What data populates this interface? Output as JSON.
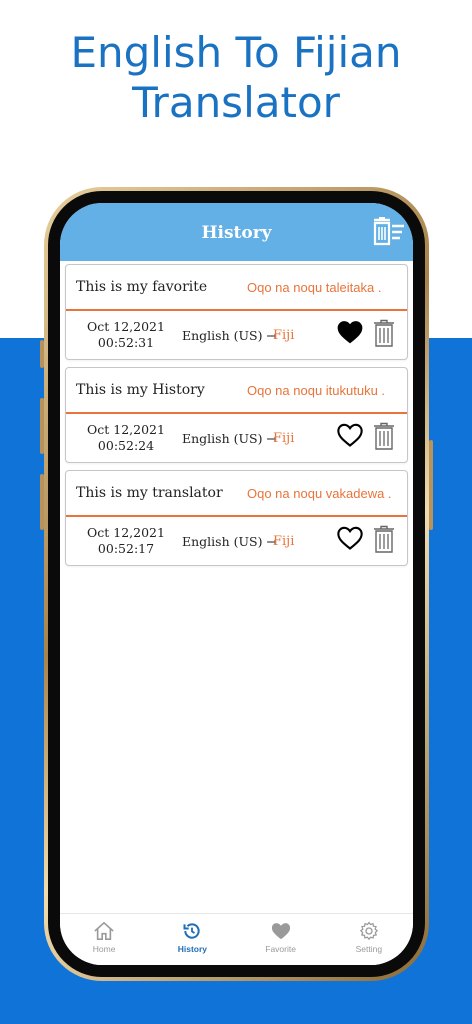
{
  "promo": {
    "line1": "English To Fijian",
    "line2": "Translator"
  },
  "colors": {
    "promo_blue": "#1a72c2",
    "band_blue": "#0f73d7",
    "header_blue": "#62b0e6",
    "accent_orange": "#e8743b",
    "active_tab": "#1f6fb8"
  },
  "header": {
    "title": "History",
    "clear_icon": "clear-all-icon"
  },
  "history": [
    {
      "source": "This is my favorite",
      "target": "Oqo na noqu taleitaka .",
      "date": "Oct 12,2021",
      "time": "00:52:31",
      "from_lang": "English (US) →",
      "to_lang": "Fiji",
      "favorite": true
    },
    {
      "source": "This is my History",
      "target": "Oqo na noqu itukutuku .",
      "date": "Oct 12,2021",
      "time": "00:52:24",
      "from_lang": "English (US) →",
      "to_lang": "Fiji",
      "favorite": false
    },
    {
      "source": "This is my translator",
      "target": "Oqo na noqu vakadewa .",
      "date": "Oct 12,2021",
      "time": "00:52:17",
      "from_lang": "English (US) →",
      "to_lang": "Fiji",
      "favorite": false
    }
  ],
  "tabs": [
    {
      "label": "Home",
      "icon": "home-icon"
    },
    {
      "label": "History",
      "icon": "history-icon",
      "active": true
    },
    {
      "label": "Favorite",
      "icon": "heart-icon"
    },
    {
      "label": "Setting",
      "icon": "gear-icon"
    }
  ]
}
